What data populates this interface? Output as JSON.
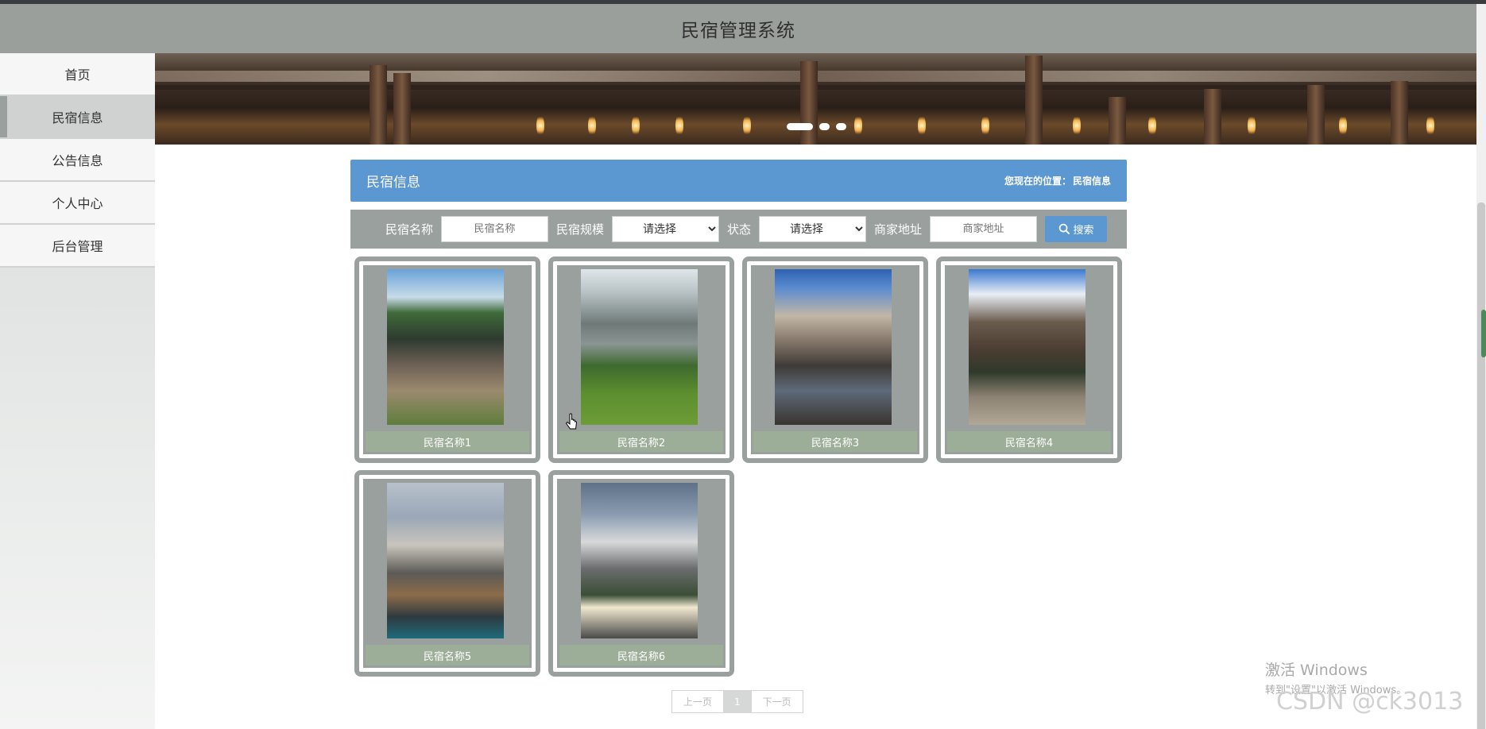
{
  "header": {
    "title": "民宿管理系统"
  },
  "sidebar": {
    "items": [
      {
        "label": "首页"
      },
      {
        "label": "民宿信息"
      },
      {
        "label": "公告信息"
      },
      {
        "label": "个人中心"
      },
      {
        "label": "后台管理"
      }
    ],
    "active": "民宿信息"
  },
  "section": {
    "title": "民宿信息",
    "location_label": "您现在的位置：",
    "location_value": "民宿信息"
  },
  "search": {
    "name_label": "民宿名称",
    "name_placeholder": "民宿名称",
    "scale_label": "民宿规模",
    "scale_value": "请选择",
    "status_label": "状态",
    "status_value": "请选择",
    "address_label": "商家地址",
    "address_placeholder": "商家地址",
    "button_label": "搜索"
  },
  "cards": [
    {
      "name": "民宿名称1"
    },
    {
      "name": "民宿名称2"
    },
    {
      "name": "民宿名称3"
    },
    {
      "name": "民宿名称4"
    },
    {
      "name": "民宿名称5"
    },
    {
      "name": "民宿名称6"
    }
  ],
  "pager": {
    "prev": "上一页",
    "current": "1",
    "next": "下一页"
  },
  "watermark": {
    "line1": "激活 Windows",
    "line2": "转到\"设置\"以激活 Windows。",
    "csdn": "CSDN @ck3013"
  },
  "colors": {
    "accent": "#5b97d0",
    "panel": "#9aa09d",
    "caption": "#9cae98"
  }
}
